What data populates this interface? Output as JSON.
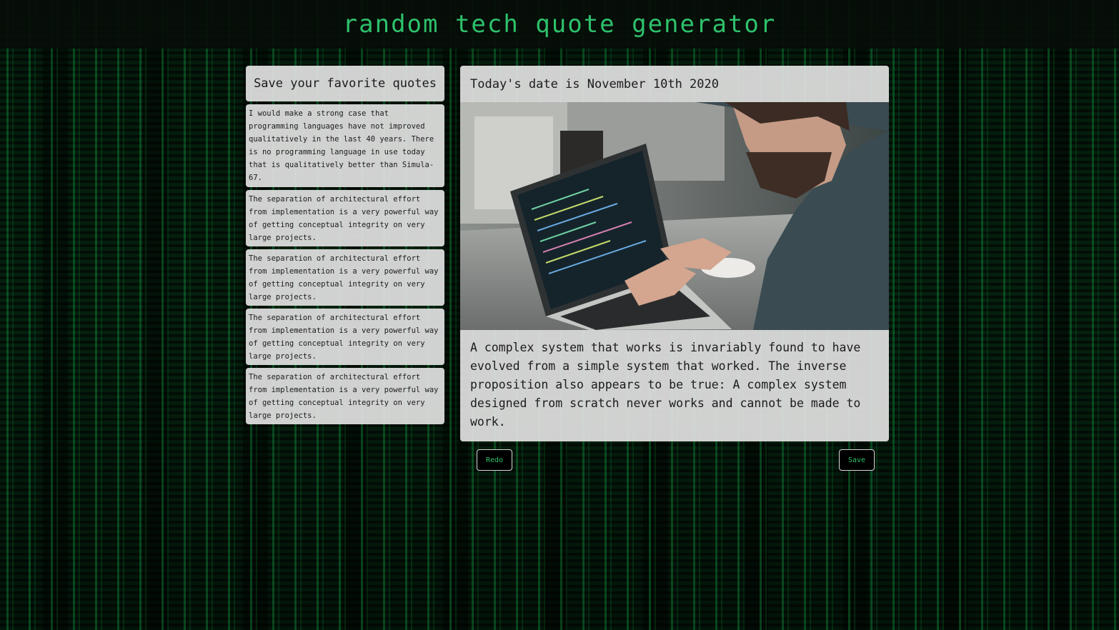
{
  "app": {
    "title": "random tech quote generator"
  },
  "sidebar": {
    "header": "Save your favorite quotes",
    "saved_quotes": [
      "I would make a strong case that programming languages have not improved qualitatively in the last 40 years. There is no programming language in use today that is qualitatively better than Simula-67.",
      "The separation of architectural effort from implementation is a very powerful way of getting conceptual integrity on very large projects.",
      "The separation of architectural effort from implementation is a very powerful way of getting conceptual integrity on very large projects.",
      "The separation of architectural effort from implementation is a very powerful way of getting conceptual integrity on very large projects.",
      "The separation of architectural effort from implementation is a very powerful way of getting conceptual integrity on very large projects."
    ]
  },
  "main": {
    "date_text": "Today's date is November 10th 2020",
    "image_subject": "developer-typing-on-laptop",
    "quote": "A complex system that works is invariably found to have evolved from a simple system that worked. The inverse proposition also appears to be true: A complex system designed from scratch never works and cannot be made to work."
  },
  "buttons": {
    "redo_label": "Redo",
    "save_label": "Save"
  },
  "colors": {
    "accent": "#2ec16b",
    "card_bg": "#e2e2e2",
    "header_bg": "#060e09"
  }
}
